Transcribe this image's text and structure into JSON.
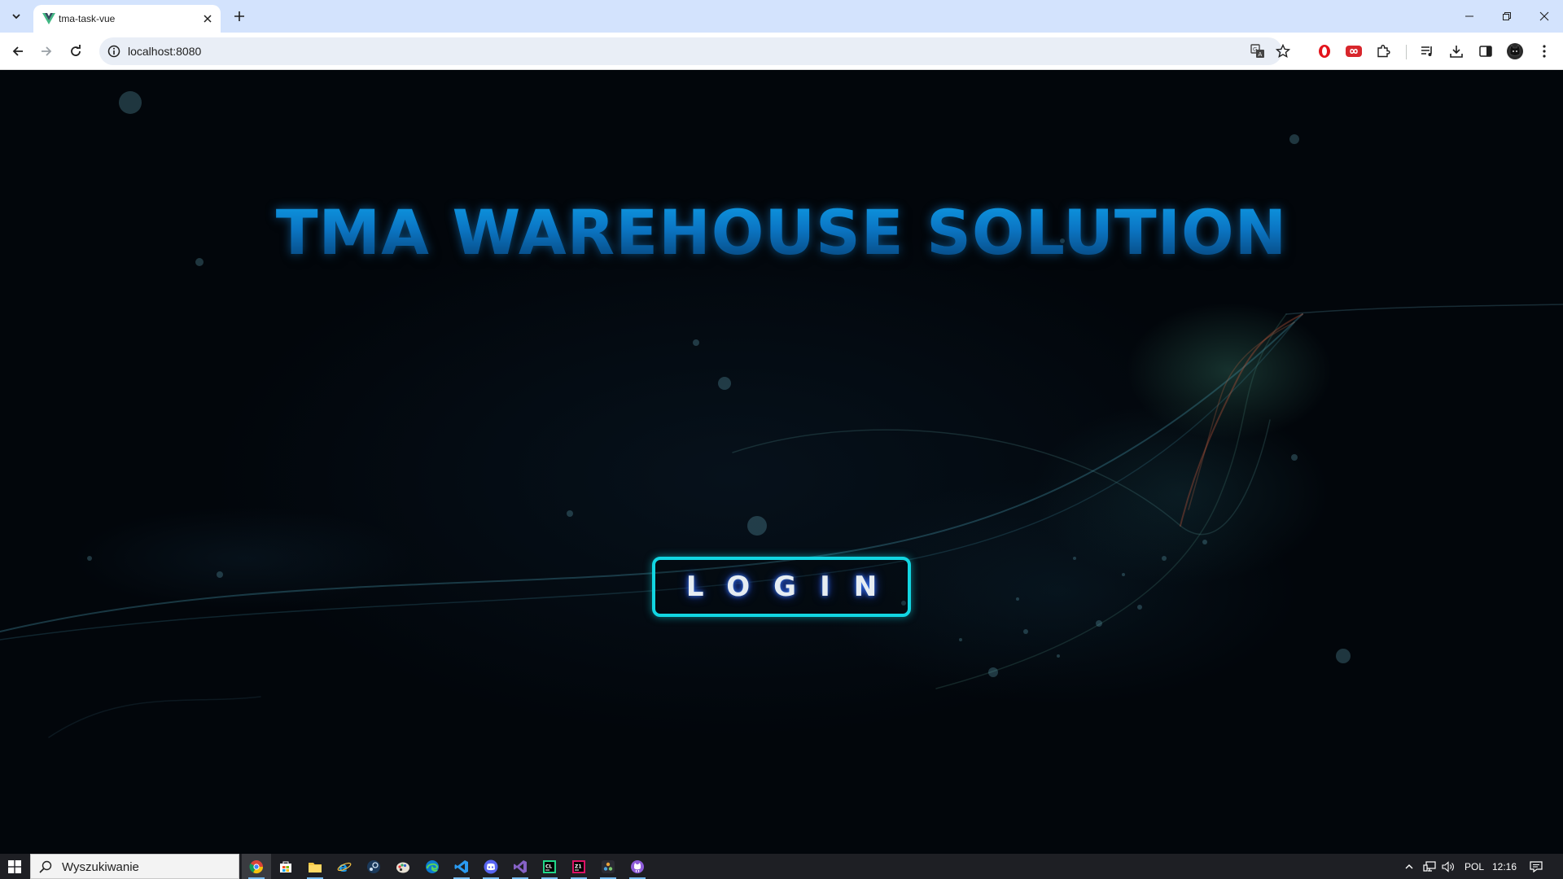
{
  "browser": {
    "tab": {
      "title": "tma-task-vue"
    },
    "address_bar": {
      "url": "localhost:8080"
    }
  },
  "page": {
    "title": "TMA WAREHOUSE SOLUTION",
    "login_button": "LOGIN"
  },
  "taskbar": {
    "search_placeholder": "Wyszukiwanie",
    "language": "POL",
    "clock": "12:16",
    "apps": [
      "chrome-icon",
      "store-icon",
      "file-explorer-icon",
      "edge-legacy-icon",
      "steam-icon",
      "paint-icon",
      "edge-icon",
      "vscode-icon",
      "discord-icon",
      "visual-studio-icon",
      "clion-icon",
      "rider-icon",
      "davinci-icon",
      "github-desktop-icon"
    ]
  },
  "colors": {
    "title_blue": "#0b76c4",
    "login_border": "#12d6e2",
    "tabbar_bg": "#d3e3fd",
    "taskbar_bg": "#1e1f24"
  }
}
